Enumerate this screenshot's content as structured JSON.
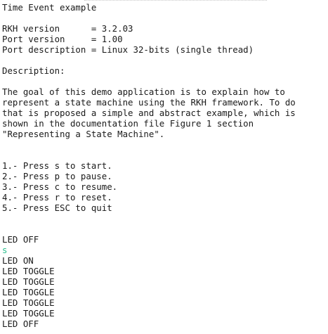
{
  "terminal": {
    "title": "Time Event example",
    "info": [
      "RKH version      = 3.2.03",
      "Port version     = 1.00",
      "Port description = Linux 32-bits (single thread)"
    ],
    "description_heading": "Description:",
    "description": [
      "The goal of this demo application is to explain how to",
      "represent a state machine using the RKH framework. To do",
      "that is proposed a simple and abstract example, which is",
      "shown in the documentation file Figure 1 section",
      "\"Representing a State Machine\"."
    ],
    "instructions": [
      "1.- Press s to start.",
      "2.- Press p to pause.",
      "3.- Press c to resume.",
      "4.- Press r to reset.",
      "5.- Press ESC to quit"
    ],
    "output": [
      "LED OFF",
      "s",
      "LED ON",
      "LED TOGGLE",
      "LED TOGGLE",
      "LED TOGGLE",
      "LED TOGGLE",
      "LED TOGGLE",
      "LED OFF"
    ],
    "colors": {
      "text": "#1a1a1a",
      "echo": "#2bbf8e",
      "background": "#ffffff"
    }
  }
}
